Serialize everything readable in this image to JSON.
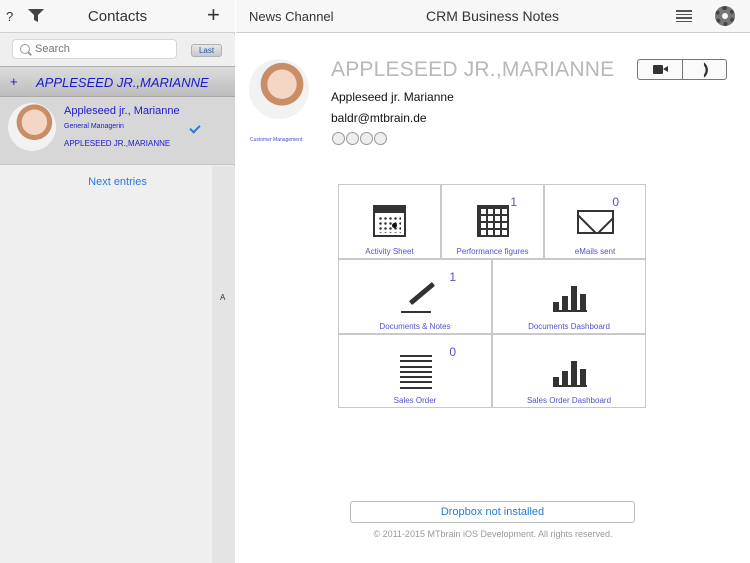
{
  "left_header": {
    "help_label": "?",
    "title": "Contacts",
    "add_label": "+"
  },
  "search": {
    "placeholder": "Search",
    "last_label": "Last"
  },
  "group": {
    "plus": "+",
    "name": "APPLESEED JR.,MARIANNE"
  },
  "contact": {
    "name": "Appleseed jr., Marianne",
    "role": "General Managerin",
    "company": "APPLESEED JR.,MARIANNE",
    "selected": true
  },
  "next_entries": "Next entries",
  "alphabet_index": [
    "A"
  ],
  "right_header": {
    "news_channel": "News Channel",
    "title": "CRM Business Notes"
  },
  "profile": {
    "big_name": "APPLESEED JR.,MARIANNE",
    "name": "Appleseed jr. Marianne",
    "email": "baldr@mtbrain.de",
    "department": "Customer Management",
    "rating": 0,
    "rating_max": 4
  },
  "tiles": {
    "activity": {
      "label": "Activity Sheet",
      "icon": "calendar-icon"
    },
    "performance": {
      "label": "Performance figures",
      "count": "1",
      "icon": "grid-icon"
    },
    "emails": {
      "label": "eMails sent",
      "count": "0",
      "icon": "envelope-icon"
    },
    "documents": {
      "label": "Documents & Notes",
      "count": "1",
      "icon": "pen-icon"
    },
    "documents_dashboard": {
      "label": "Documents Dashboard",
      "icon": "bar-chart-icon"
    },
    "sales_order": {
      "label": "Sales Order",
      "count": "0",
      "icon": "list-lines-icon"
    },
    "sales_order_dashboard": {
      "label": "Sales Order Dashboard",
      "icon": "bar-chart-icon"
    }
  },
  "dropbox_label": "Dropbox not installed",
  "copyright": "© 2011-2015 MTbrain iOS Development. All rights reserved.",
  "colors": {
    "accent": "#2a7ad8",
    "link_violet": "#5252cc",
    "name_blue": "#1a1acc"
  }
}
